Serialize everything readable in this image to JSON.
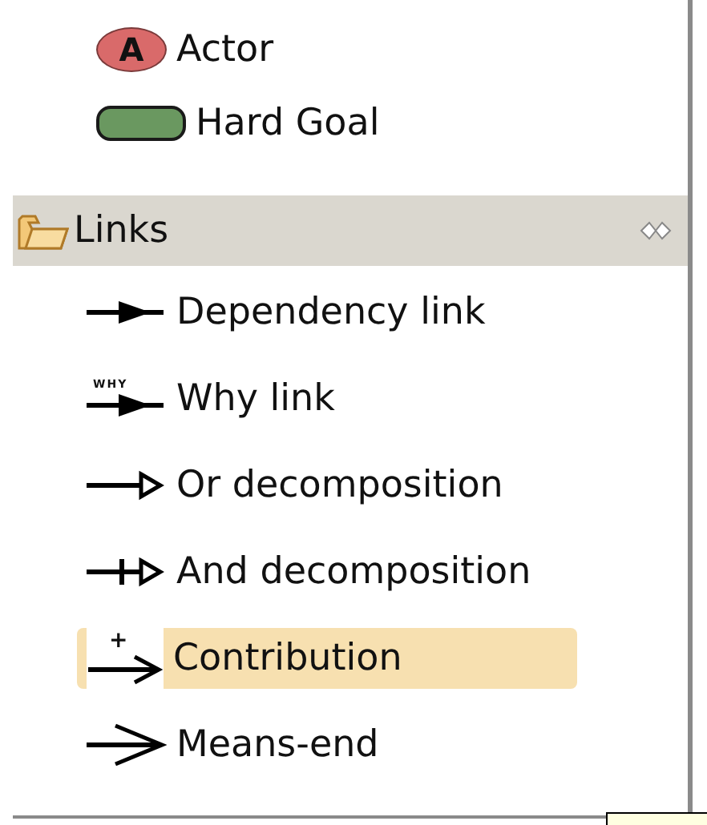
{
  "palette_items": [
    {
      "label": "Actor",
      "kind": "actor",
      "icon_text": "A"
    },
    {
      "label": "Hard Goal",
      "kind": "goal"
    }
  ],
  "links_drawer": {
    "title": "Links",
    "items": [
      {
        "label": "Dependency link",
        "kind": "dependency",
        "selected": false
      },
      {
        "label": "Why link",
        "kind": "why",
        "icon_text": "WHY",
        "selected": false
      },
      {
        "label": "Or decomposition",
        "kind": "or",
        "selected": false
      },
      {
        "label": "And decomposition",
        "kind": "and",
        "selected": false
      },
      {
        "label": "Contribution",
        "kind": "contribution",
        "icon_text": "+",
        "selected": true
      },
      {
        "label": "Means-end",
        "kind": "meansend",
        "selected": false
      }
    ]
  }
}
